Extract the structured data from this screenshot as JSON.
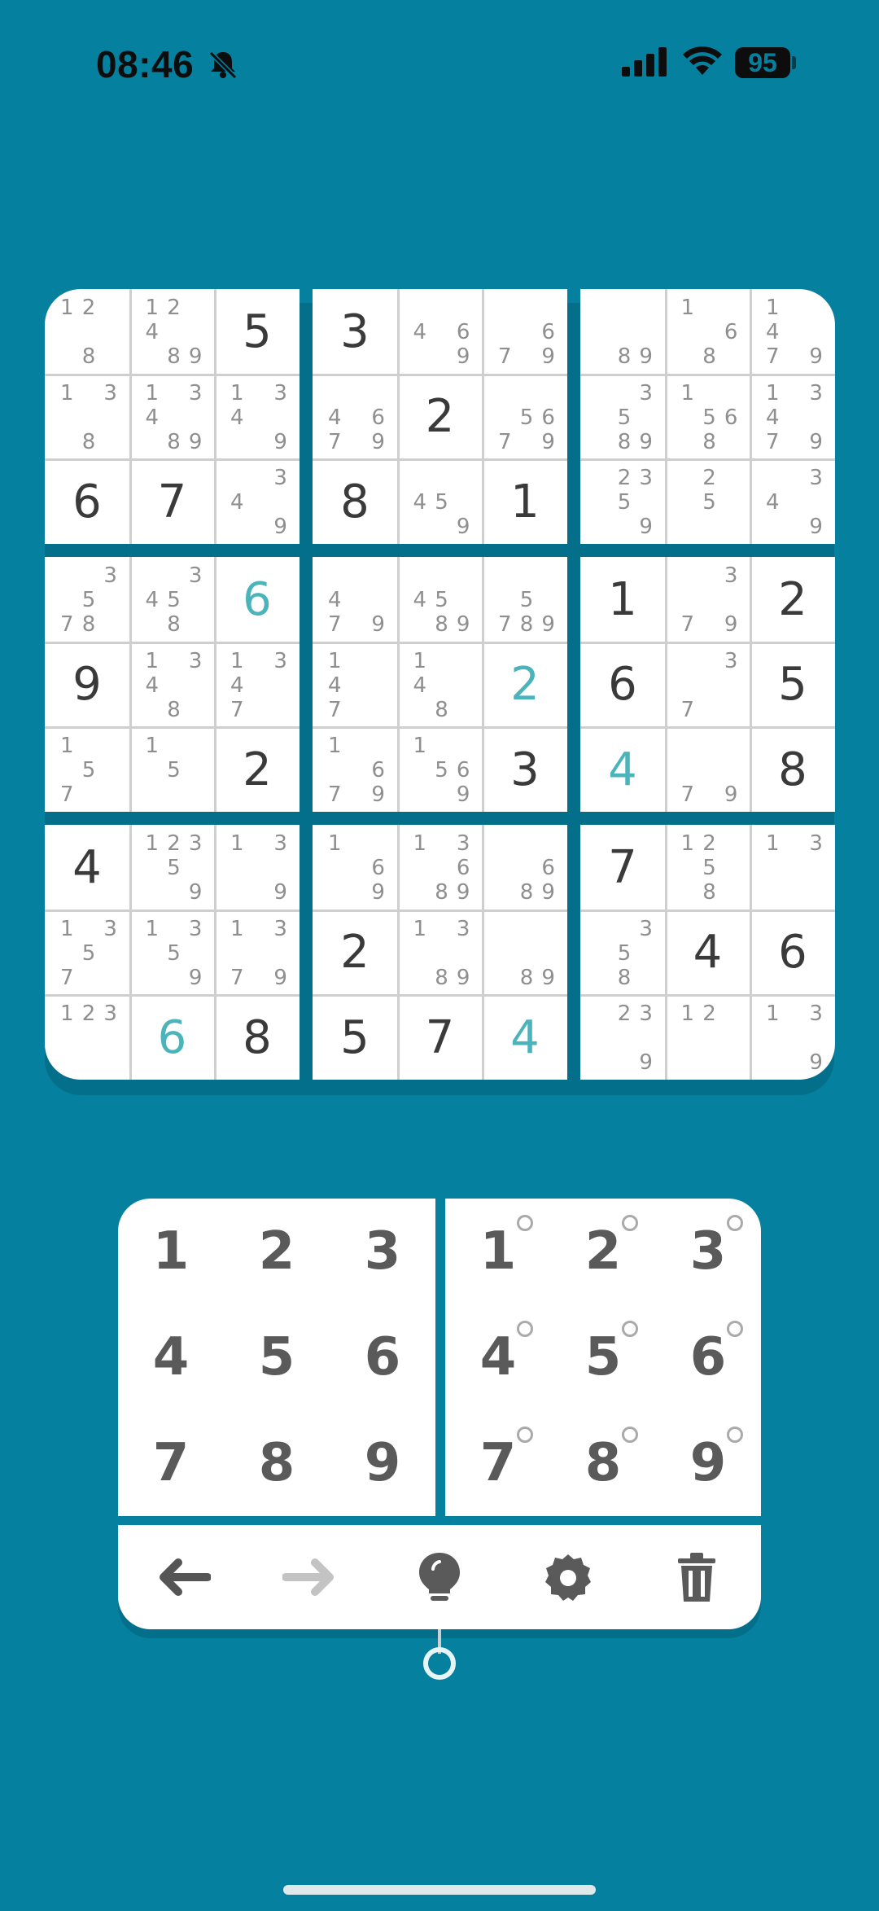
{
  "status_bar": {
    "time": "08:46",
    "battery": "95",
    "icons": [
      "bell-slash-icon",
      "cellular-signal-icon",
      "wifi-icon",
      "battery-icon"
    ]
  },
  "colors": {
    "background": "#06809F",
    "board": "#FFFFFF",
    "given_digit": "#3A3A3A",
    "user_digit": "#4BB3BA",
    "pencil_mark": "#8F8F8F"
  },
  "grid": [
    [
      {
        "n": "1 2 . . . . . 8 ."
      },
      {
        "n": "1 2 . 4 . . . 8 9"
      },
      {
        "v": "5"
      },
      {
        "v": "3"
      },
      {
        "n": ". . . 4 . 6 . . 9"
      },
      {
        "n": ". . . . . 6 7 . 9"
      },
      {
        "n": ". . . . . . . 8 9"
      },
      {
        "n": "1 . . . . 6 . 8 ."
      },
      {
        "n": "1 . . 4 . . 7 . 9"
      }
    ],
    [
      {
        "n": "1 . 3 . . . . 8 ."
      },
      {
        "n": "1 . 3 4 . . . 8 9"
      },
      {
        "n": "1 . 3 4 . . . . 9"
      },
      {
        "n": ". . . 4 . 6 7 . 9"
      },
      {
        "v": "2"
      },
      {
        "n": ". . . . 5 6 7 . 9"
      },
      {
        "n": ". . 3 . 5 . . 8 9"
      },
      {
        "n": "1 . . . 5 6 . 8 ."
      },
      {
        "n": "1 . 3 4 . . 7 . 9"
      }
    ],
    [
      {
        "v": "6"
      },
      {
        "v": "7"
      },
      {
        "n": ". . 3 4 . . . . 9"
      },
      {
        "v": "8"
      },
      {
        "n": ". . . 4 5 . . . 9"
      },
      {
        "v": "1"
      },
      {
        "n": ". 2 3 . 5 . . . 9"
      },
      {
        "n": ". 2 . . 5 . . . ."
      },
      {
        "n": ". . 3 4 . . . . 9"
      }
    ],
    [
      {
        "n": ". . 3 . 5 . 7 8 ."
      },
      {
        "n": ". . 3 4 5 . . 8 ."
      },
      {
        "v": "6",
        "u": true
      },
      {
        "n": ". . . 4 . . 7 . 9"
      },
      {
        "n": ". . . 4 5 . . 8 9"
      },
      {
        "n": ". . . . 5 . 7 8 9"
      },
      {
        "v": "1"
      },
      {
        "n": ". . 3 . . . 7 . 9"
      },
      {
        "v": "2"
      }
    ],
    [
      {
        "v": "9"
      },
      {
        "n": "1 . 3 4 . . . 8 ."
      },
      {
        "n": "1 . 3 4 . . 7 . ."
      },
      {
        "n": "1 . . 4 . . 7 . ."
      },
      {
        "n": "1 . . 4 . . . 8 ."
      },
      {
        "v": "2",
        "u": true
      },
      {
        "v": "6"
      },
      {
        "n": ". . 3 . . . 7 . ."
      },
      {
        "v": "5"
      }
    ],
    [
      {
        "n": "1 . . . 5 . 7 . ."
      },
      {
        "n": "1 . . . 5 . . . ."
      },
      {
        "v": "2"
      },
      {
        "n": "1 . . . . 6 7 . 9"
      },
      {
        "n": "1 . . . 5 6 . . 9"
      },
      {
        "v": "3"
      },
      {
        "v": "4",
        "u": true
      },
      {
        "n": ". . . . . . 7 . 9"
      },
      {
        "v": "8"
      }
    ],
    [
      {
        "v": "4"
      },
      {
        "n": "1 2 3 . 5 . . . 9"
      },
      {
        "n": "1 . 3 . . . . . 9"
      },
      {
        "n": "1 . . . . 6 . . 9"
      },
      {
        "n": "1 . 3 . . 6 . 8 9"
      },
      {
        "n": ". . . . . 6 . 8 9"
      },
      {
        "v": "7"
      },
      {
        "n": "1 2 . . 5 . . 8 ."
      },
      {
        "n": "1 . 3 . . . . . ."
      }
    ],
    [
      {
        "n": "1 . 3 . 5 . 7 . ."
      },
      {
        "n": "1 . 3 . 5 . . . 9"
      },
      {
        "n": "1 . 3 . . . 7 . 9"
      },
      {
        "v": "2"
      },
      {
        "n": "1 . 3 . . . . 8 9"
      },
      {
        "n": ". . . . . . . 8 9"
      },
      {
        "n": ". . 3 . 5 . . 8 ."
      },
      {
        "v": "4"
      },
      {
        "v": "6"
      }
    ],
    [
      {
        "n": "1 2 3 . . . . . ."
      },
      {
        "v": "6",
        "u": true
      },
      {
        "v": "8"
      },
      {
        "v": "5"
      },
      {
        "v": "7"
      },
      {
        "v": "4",
        "u": true
      },
      {
        "n": ". 2 3 . . . . . 9"
      },
      {
        "n": "1 2 . . . . . . ."
      },
      {
        "n": "1 . 3 . . . . . 9"
      }
    ]
  ],
  "keypad": {
    "digits": [
      "1",
      "2",
      "3",
      "4",
      "5",
      "6",
      "7",
      "8",
      "9"
    ],
    "note_digits": [
      "1",
      "2",
      "3",
      "4",
      "5",
      "6",
      "7",
      "8",
      "9"
    ]
  },
  "toolbar": {
    "tools": [
      "undo-arrow-icon",
      "redo-arrow-icon",
      "hint-bulb-icon",
      "settings-gear-icon",
      "clear-trash-icon"
    ]
  }
}
